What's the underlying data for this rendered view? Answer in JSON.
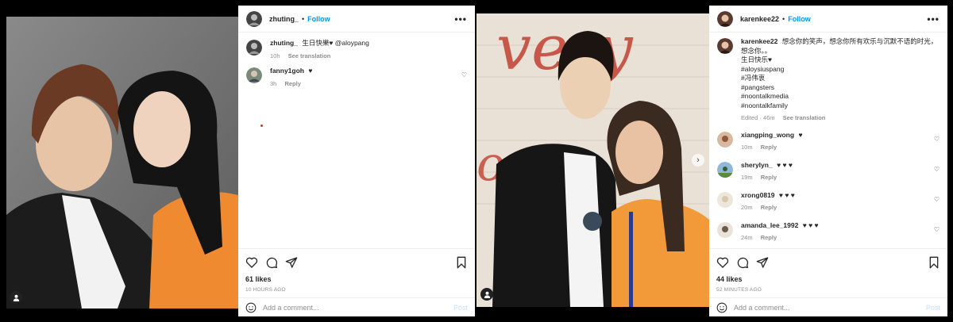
{
  "posts": [
    {
      "header": {
        "username": "zhuting_",
        "dot": "•",
        "follow": "Follow"
      },
      "comments": [
        {
          "user": "zhuting_",
          "text": "生日快樂♥ @aloypang",
          "time": "10h",
          "action": "See translation"
        },
        {
          "user": "fanny1goh",
          "text": "♥",
          "time": "3h",
          "action": "Reply"
        }
      ],
      "likes": "61 likes",
      "ago": "10 HOURS AGO",
      "add_placeholder": "Add a comment...",
      "post_label": "Post"
    },
    {
      "header": {
        "username": "karenkee22",
        "dot": "•",
        "follow": "Follow"
      },
      "caption": {
        "user": "karenkee22",
        "text": "想念你的笑声，想念你所有欢乐与沉默不语的时光，想念你。。",
        "line2": "生日快乐♥",
        "tags": [
          "#aloysiuspang",
          "#冯伟衷",
          "#pangsters",
          "#noontalkmedia",
          "#noontalkfamily"
        ],
        "edited": "Edited · 46m",
        "action": "See translation"
      },
      "comments": [
        {
          "user": "xiangping_wong",
          "text": "♥",
          "time": "10m",
          "action": "Reply"
        },
        {
          "user": "sherylyn_",
          "text": "♥ ♥ ♥",
          "time": "19m",
          "action": "Reply"
        },
        {
          "user": "xrong0819",
          "text": "♥ ♥ ♥",
          "time": "20m",
          "action": "Reply"
        },
        {
          "user": "amanda_lee_1992",
          "text": "♥ ♥ ♥",
          "time": "24m",
          "action": "Reply"
        }
      ],
      "likes": "44 likes",
      "ago": "52 MINUTES AGO",
      "add_placeholder": "Add a comment...",
      "post_label": "Post"
    }
  ],
  "icons": [
    "heart-icon",
    "comment-icon",
    "share-icon",
    "bookmark-icon",
    "emoji-icon",
    "more-icon",
    "user-tag-icon",
    "next-arrow-icon"
  ]
}
